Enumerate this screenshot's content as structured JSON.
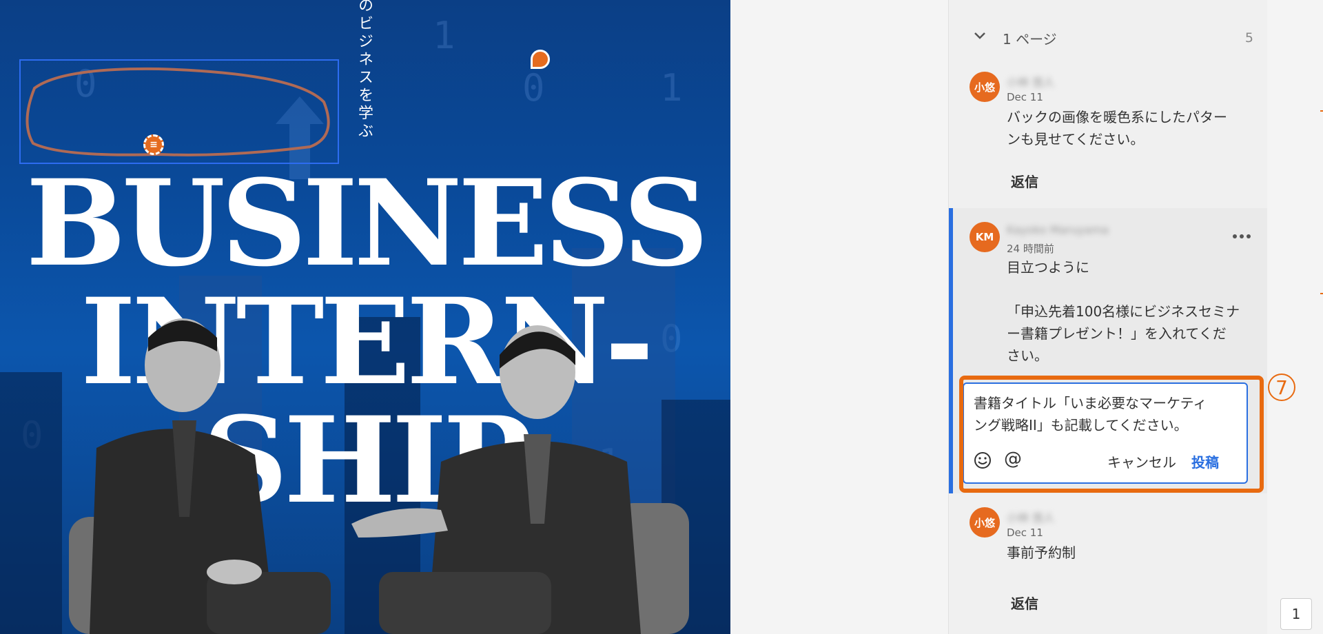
{
  "document": {
    "vertical_text": "のビジネスを学ぶ",
    "headline_lines": [
      "BUSINESS",
      "INTERN-",
      "SHIP"
    ],
    "background_digits": [
      "0",
      "1",
      "1",
      "0",
      "0",
      "1",
      "0"
    ]
  },
  "comments_panel": {
    "page_label": "1 ページ",
    "count": "5",
    "comments": [
      {
        "avatar": "小悠",
        "author": "小林 悠人",
        "date": "Dec 11",
        "body": "バックの画像を暖色系にしたパター\nンも見せてください。",
        "reply_label": "返信"
      },
      {
        "avatar": "KM",
        "author": "Kayoko Maruyama",
        "date": "24 時間前",
        "body": "目立つように\n\n「申込先着100名様にビジネスセミナ\nー書籍プレゼント！」を入れてくだ\nさい。"
      },
      {
        "avatar": "小悠",
        "author": "小林 悠人",
        "date": "Dec 11",
        "body": "事前予約制",
        "reply_label": "返信"
      }
    ],
    "reply_box": {
      "text": "書籍タイトル「いま必要なマーケティ\nング戦略II」も記載してください。",
      "cancel_label": "キャンセル",
      "post_label": "投稿"
    }
  },
  "step_badge": "7",
  "page_number": "1",
  "colors": {
    "accent_orange": "#e86a10",
    "selection_blue": "#2a6fe0",
    "poster_blue": "#0a4a9a"
  }
}
